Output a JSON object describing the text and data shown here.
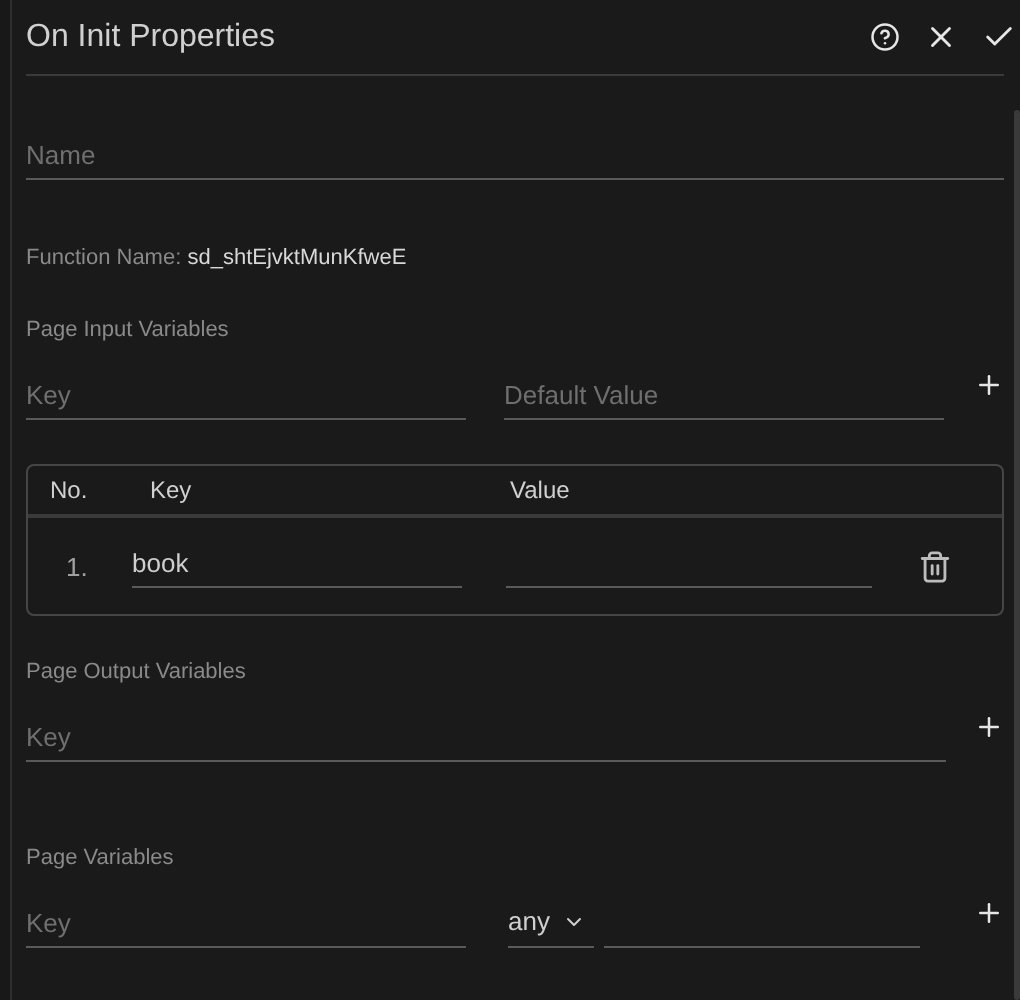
{
  "window": {
    "title": "On Init Properties"
  },
  "name_field": {
    "placeholder": "Name"
  },
  "function_name": {
    "label": "Function Name:",
    "value": "sd_shtEjvktMunKfweE"
  },
  "input_variables": {
    "title": "Page Input Variables",
    "key_placeholder": "Key",
    "value_placeholder": "Default Value",
    "table": {
      "columns": [
        "No.",
        "Key",
        "Value"
      ],
      "rows": [
        {
          "number": "1.",
          "key": "book"
        }
      ]
    }
  },
  "output_variables": {
    "title": "Page Output Variables",
    "key_placeholder": "Key"
  },
  "page_variables": {
    "title": "Page Variables",
    "key_placeholder": "Key",
    "type": "any"
  }
}
